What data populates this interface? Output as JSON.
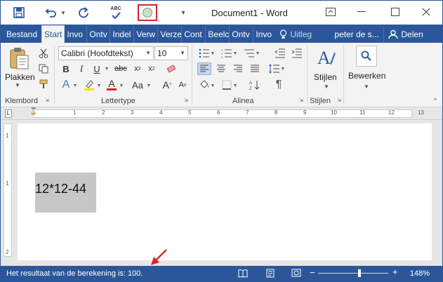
{
  "window": {
    "title": "Document1 - Word"
  },
  "tabs": [
    {
      "label": "Bestand"
    },
    {
      "label": "Start"
    },
    {
      "label": "Invo"
    },
    {
      "label": "Ontv"
    },
    {
      "label": "Indel"
    },
    {
      "label": "Verw"
    },
    {
      "label": "Verze"
    },
    {
      "label": "Cont"
    },
    {
      "label": "Beelc"
    },
    {
      "label": "Ontv"
    },
    {
      "label": "Invo"
    }
  ],
  "tell_me": "Uitleg",
  "user": "peter de s...",
  "share": "Delen",
  "ribbon": {
    "paste": "Plakken",
    "clipboard": "Klembord",
    "font_name": "Calibri (Hoofdtekst)",
    "font_size": "10",
    "font_group": "Lettertype",
    "paragraph_group": "Alinea",
    "styles": "Stijlen",
    "styles_group": "Stijlen",
    "editing": "Bewerken"
  },
  "ruler": {
    "ticks": [
      "1",
      "2",
      "3",
      "4",
      "5",
      "6",
      "7",
      "8",
      "9",
      "10",
      "11",
      "12",
      "13"
    ]
  },
  "vruler": {
    "ticks": [
      "1",
      "1",
      "2"
    ]
  },
  "document": {
    "text": "12*12-44"
  },
  "status": {
    "message": "Het resultaat van de berekening is: 100.",
    "zoom": "148%"
  },
  "colors": {
    "accent": "#2b579a",
    "highlight_box": "#d9262c",
    "arrow": "#d9262c"
  }
}
